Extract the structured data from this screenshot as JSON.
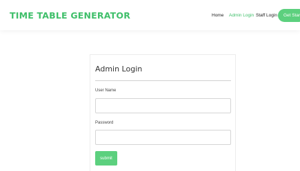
{
  "header": {
    "brand": "TIME TABLE GENERATOR",
    "nav": {
      "home": "Home",
      "admin_login": "Admin Login",
      "staff_login": "Staff Login"
    },
    "cta_label": "Get Started"
  },
  "login": {
    "title": "Admin Login",
    "username_label": "User Name",
    "username_value": "",
    "password_label": "Password",
    "password_value": "",
    "submit_label": "submit"
  },
  "colors": {
    "accent": "#3fbf6a",
    "button": "#5cd07e"
  }
}
